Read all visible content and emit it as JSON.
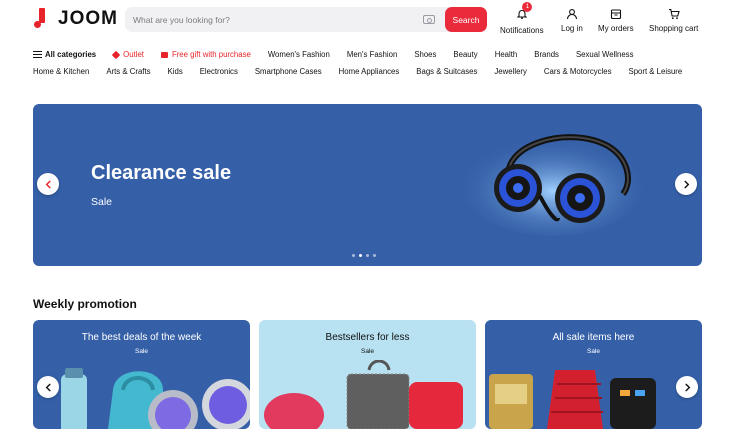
{
  "header": {
    "logo_text": "JOOM",
    "search_placeholder": "What are you looking for?",
    "search_button": "Search",
    "notifications_label": "Notifications",
    "notifications_count": "1",
    "login_label": "Log in",
    "orders_label": "My orders",
    "cart_label": "Shopping cart"
  },
  "categories_row1": [
    "All categories",
    "Outlet",
    "Free gift with purchase",
    "Women's Fashion",
    "Men's Fashion",
    "Shoes",
    "Beauty",
    "Health",
    "Brands",
    "Sexual Wellness"
  ],
  "categories_row2": [
    "Home & Kitchen",
    "Arts & Crafts",
    "Kids",
    "Electronics",
    "Smartphone Cases",
    "Home Appliances",
    "Bags & Suitcases",
    "Jewellery",
    "Cars & Motorcycles",
    "Sport & Leisure"
  ],
  "hero": {
    "title": "Clearance sale",
    "subtitle": "Sale",
    "background": "#3560a8",
    "slide_count": 4,
    "active_slide": 2
  },
  "weekly": {
    "heading": "Weekly promotion",
    "cards": [
      {
        "title": "The best deals of the week",
        "subtitle": "Sale",
        "color": "#3560a8"
      },
      {
        "title": "Bestsellers for less",
        "subtitle": "Sale",
        "color": "#b8e1f1"
      },
      {
        "title": "All sale items here",
        "subtitle": "Sale",
        "color": "#3560a8"
      }
    ]
  },
  "colors": {
    "accent": "#ea2b3b",
    "brand": "#e8232a"
  },
  "icons": {
    "prev": "chevron-left-icon",
    "next": "chevron-right-icon"
  }
}
